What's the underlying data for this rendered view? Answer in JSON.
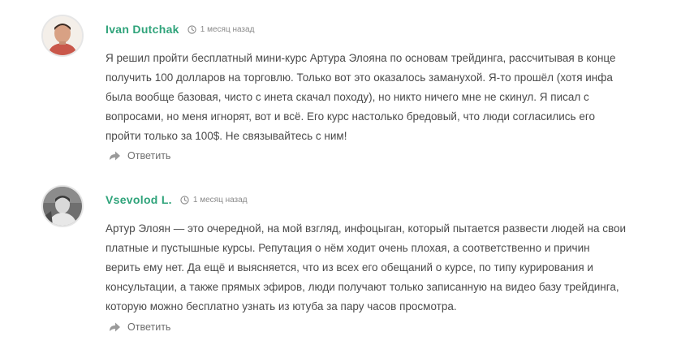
{
  "comments": [
    {
      "author": "Ivan Dutchak",
      "time": "1 месяц назад",
      "avatar_icon": "user-avatar-photo",
      "lines": [
        "Я решил пройти бесплатный мини-курс Артура Элояна по основам трейдинга, рассчитывая в конце",
        "получить 100 долларов на торговлю. Только вот это оказалось заманухой. Я-то прошёл (хотя инфа",
        "была вообще базовая, чисто с инета скачал походу), но никто ничего мне не скинул. Я писал с",
        "вопросами, но меня игнорят, вот и всё. Его курс настолько бредовый, что люди согласились его",
        "пройти только за 100$. Не связывайтесь с ним!"
      ],
      "reply_label": "Ответить"
    },
    {
      "author": "Vsevolod L.",
      "time": "1 месяц назад",
      "avatar_icon": "user-avatar-photo",
      "lines": [
        "Артур Элоян — это очередной, на мой взгляд, инфоцыган, который пытается развести людей на свои",
        "платные и пустышные курсы. Репутация о нём ходит очень плохая, а соответственно и причин",
        "верить ему нет. Да ещё и выясняется, что из всех его обещаний о курсе, по типу курирования и",
        "консультации, а также прямых эфиров, люди получают только записанную на видео базу трейдинга,",
        "которую можно бесплатно узнать из ютуба за пару часов просмотра."
      ],
      "reply_label": "Ответить"
    }
  ],
  "colors": {
    "author": "#2fa37a",
    "text": "#4a4a4a",
    "meta": "#8a8a8a",
    "reply": "#6e6e6e"
  },
  "icons": {
    "time": "clock-icon",
    "reply": "reply-arrow-icon"
  }
}
